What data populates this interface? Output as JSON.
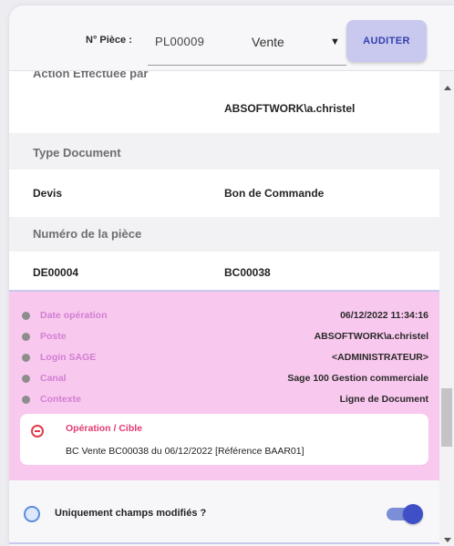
{
  "toolbar": {
    "piece_label": "N° Pièce :",
    "piece_value": "PL00009",
    "piece_type": "Vente",
    "audit_button": "AUDITER"
  },
  "table": {
    "action_header": "Action Effectuée par",
    "action_new": "ABSOFTWORK\\a.christel",
    "type_header": "Type Document",
    "type_old": "Devis",
    "type_new": "Bon de Commande",
    "number_header": "Numéro de la pièce",
    "number_old": "DE00004",
    "number_new": "BC00038"
  },
  "info": [
    {
      "label": "Date opération",
      "value": "06/12/2022 11:34:16"
    },
    {
      "label": "Poste",
      "value": "ABSOFTWORK\\a.christel"
    },
    {
      "label": "Login SAGE",
      "value": "<ADMINISTRATEUR>"
    },
    {
      "label": "Canal",
      "value": "Sage 100 Gestion commerciale"
    },
    {
      "label": "Contexte",
      "value": "Ligne de Document"
    }
  ],
  "operation": {
    "title": "Opération / Cible",
    "text": "BC Vente BC00038 du 06/12/2022 [Référence BAAR01]"
  },
  "footer": {
    "label": "Uniquement champs modifiés ?",
    "toggle_on": true
  },
  "colors": {
    "accent": "#3e4fc7",
    "pink_panel": "#f9c8ee",
    "label_pink": "#d17fd3",
    "button_bg": "#c9c8ee",
    "error_red": "#e23b4b"
  }
}
